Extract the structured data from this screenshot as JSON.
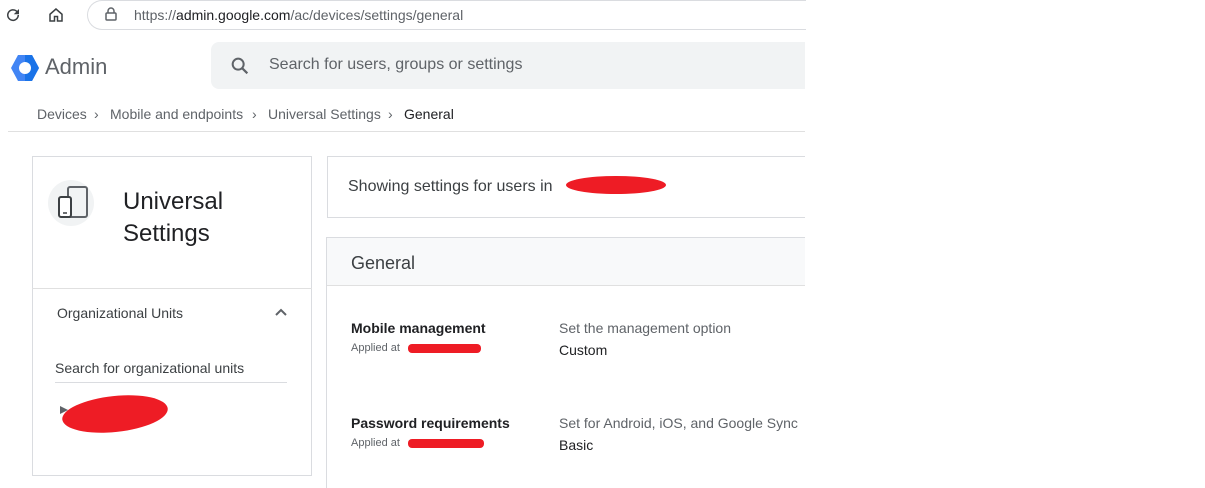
{
  "browser": {
    "url_prefix": "https://",
    "url_domain": "admin.google.com",
    "url_path": "/ac/devices/settings/general"
  },
  "app": {
    "name": "Admin",
    "search_placeholder": "Search for users, groups or settings"
  },
  "breadcrumb": {
    "items": [
      "Devices",
      "Mobile and endpoints",
      "Universal Settings",
      "General"
    ]
  },
  "sidebar": {
    "title_line1": "Universal",
    "title_line2": "Settings",
    "ou_label": "Organizational Units",
    "ou_search_placeholder": "Search for organizational units"
  },
  "main": {
    "showing_text": "Showing settings for users in",
    "section_title": "General",
    "settings": [
      {
        "name": "Mobile management",
        "applied": "Applied at",
        "description": "Set the management option",
        "value": "Custom"
      },
      {
        "name": "Password requirements",
        "applied": "Applied at",
        "description": "Set for Android, iOS, and Google Sync",
        "value": "Basic"
      }
    ]
  },
  "colors": {
    "accent": "#4285f4",
    "redaction": "#ee1c25"
  }
}
